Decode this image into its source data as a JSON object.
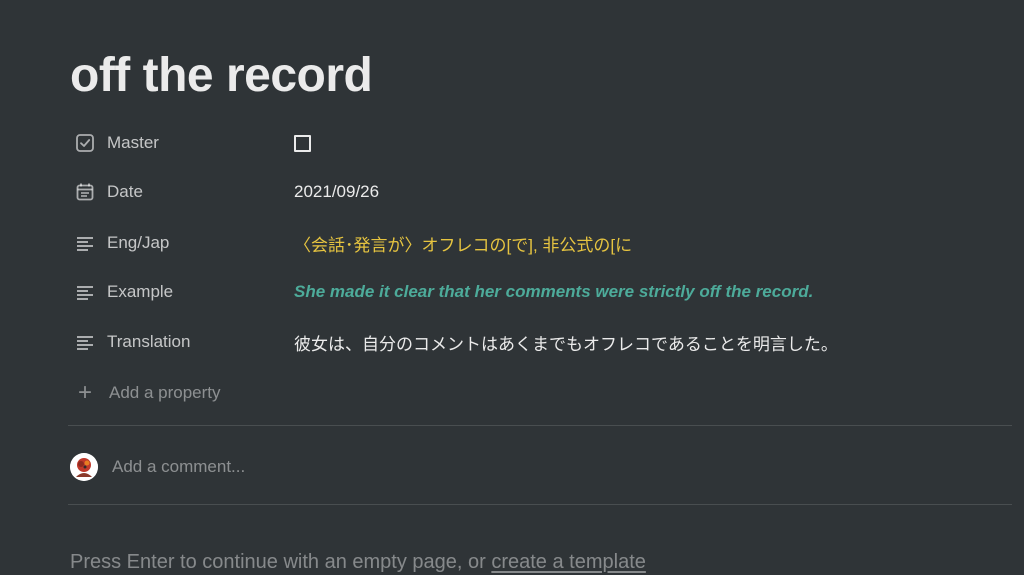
{
  "page": {
    "title": "off the record"
  },
  "properties": [
    {
      "name": "Master",
      "icon": "checkbox-icon",
      "type": "checkbox",
      "checked": false
    },
    {
      "name": "Date",
      "icon": "calendar-icon",
      "type": "date",
      "value": "2021/09/26"
    },
    {
      "name": "Eng/Jap",
      "icon": "text-lines-icon",
      "type": "text",
      "value": "〈会話･発言が〉オフレコの[で], 非公式の[に",
      "color": "#e6c440"
    },
    {
      "name": "Example",
      "icon": "text-lines-icon",
      "type": "text",
      "value": "She made it clear that her comments were strictly off the record.",
      "color": "#4dab9a"
    },
    {
      "name": "Translation",
      "icon": "text-lines-icon",
      "type": "text",
      "value": "彼女は、自分のコメントはあくまでもオフレコであることを明言した。"
    }
  ],
  "add_property": {
    "label": "Add a property"
  },
  "comment": {
    "placeholder": "Add a comment..."
  },
  "footer": {
    "hint_text": "Press Enter to continue with an empty page, or ",
    "link_text": "create a template"
  },
  "colors": {
    "background": "#2f3437",
    "yellow_text": "#e6c440",
    "green_text": "#4dab9a"
  }
}
